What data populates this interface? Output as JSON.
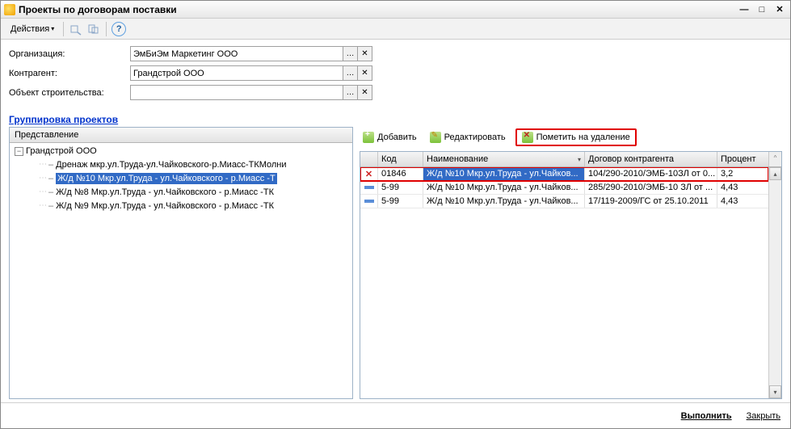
{
  "window": {
    "title": "Проекты по договорам поставки"
  },
  "toolbar": {
    "actions_label": "Действия"
  },
  "form": {
    "org_label": "Организация:",
    "org_value": "ЭмБиЭм Маркетинг ООО",
    "counterparty_label": "Контрагент:",
    "counterparty_value": "Грандстрой ООО",
    "object_label": "Объект строительства:",
    "object_value": ""
  },
  "section_title": "Группировка проектов",
  "tree": {
    "header": "Представление",
    "root": "Грандстрой ООО",
    "items": [
      "Дренаж мкр.ул.Труда-ул.Чайковского-р.Миасс-ТКМолни",
      "Ж/д №10 Мкр.ул.Труда - ул.Чайковского - р.Миасс -Т",
      "Ж/д №8 Мкр.ул.Труда - ул.Чайковского - р.Миасс -ТК",
      "Ж/д №9 Мкр.ул.Труда - ул.Чайковского - р.Миасс -ТК"
    ],
    "selected_index": 1
  },
  "right_toolbar": {
    "add": "Добавить",
    "edit": "Редактировать",
    "delete": "Пометить на удаление"
  },
  "grid": {
    "columns": {
      "code": "Код",
      "name": "Наименование",
      "contract": "Договор контрагента",
      "percent": "Процент"
    },
    "rows": [
      {
        "code": "01846",
        "name": "Ж/д №10 Мкр.ул.Труда - ул.Чайков...",
        "contract": "104/290-2010/ЭМБ-10ЗЛ от 0...",
        "percent": "3,2",
        "deleted": true,
        "selected": true
      },
      {
        "code": "5-99",
        "name": "Ж/д №10 Мкр.ул.Труда - ул.Чайков...",
        "contract": "285/290-2010/ЭМБ-10 ЗЛ от ...",
        "percent": "4,43",
        "deleted": false,
        "selected": false
      },
      {
        "code": "5-99",
        "name": "Ж/д №10 Мкр.ул.Труда - ул.Чайков...",
        "contract": "17/119-2009/ГС от 25.10.2011",
        "percent": "4,43",
        "deleted": false,
        "selected": false
      }
    ]
  },
  "footer": {
    "execute": "Выполнить",
    "close": "Закрыть"
  }
}
